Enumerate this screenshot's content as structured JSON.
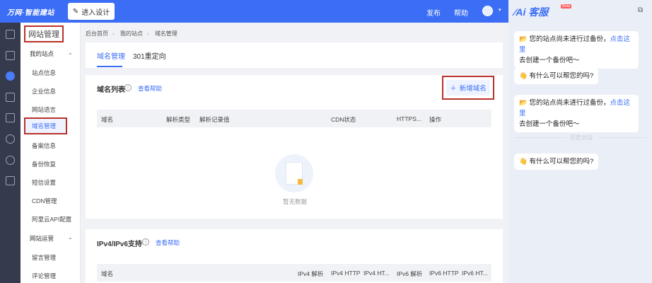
{
  "topbar": {
    "logo": "万网·智能建站",
    "enter_design": "进入设计",
    "publish": "发布",
    "help": "帮助"
  },
  "sidebar": {
    "title": "网站管理",
    "group_my_site": "我的站点",
    "items": [
      "站点信息",
      "企业信息",
      "网站语言",
      "域名管理",
      "备案信息",
      "备份恢复",
      "短信设置",
      "CDN管理",
      "阿里云API配置"
    ],
    "group_operation": "网站运营",
    "operation_items": [
      "留言管理",
      "评论管理"
    ]
  },
  "breadcrumb": [
    "后台首页",
    "我的站点",
    "域名管理"
  ],
  "tabs": [
    "域名管理",
    "301重定向"
  ],
  "domain_list": {
    "title": "域名列表",
    "help": "查看帮助",
    "add_button": "新增域名",
    "columns": [
      "域名",
      "解析类型",
      "解析记录值",
      "CDN状态",
      "HTTPS...",
      "操作"
    ],
    "empty_text": "暂无数据"
  },
  "ipv6": {
    "title": "IPv4/IPv6支持",
    "help": "查看帮助",
    "columns": [
      "域名",
      "IPv4 解析",
      "IPv4 HTTP",
      "IPv4 HT...",
      "IPv6 解析",
      "IPv6 HTTP",
      "IPv6 HT..."
    ]
  },
  "chat": {
    "logo_text": "Ai 客服",
    "badge": "Beta",
    "messages": [
      {
        "emoji": "📂",
        "text": "您的站点尚未进行过备份，",
        "link": "点击这里",
        "text2": "去创建一个备份吧～"
      },
      {
        "emoji": "👋",
        "text": "有什么可以帮您的吗?"
      },
      {
        "emoji": "📂",
        "text": "您的站点尚未进行过备份，",
        "link": "点击这里",
        "text2": "去创建一个备份吧～"
      },
      {
        "emoji": "👋",
        "text": "有什么可以帮您的吗?"
      }
    ],
    "history_label": "历史对话"
  },
  "colors": {
    "primary": "#3b6ef5",
    "highlight_box": "#b8322a"
  }
}
